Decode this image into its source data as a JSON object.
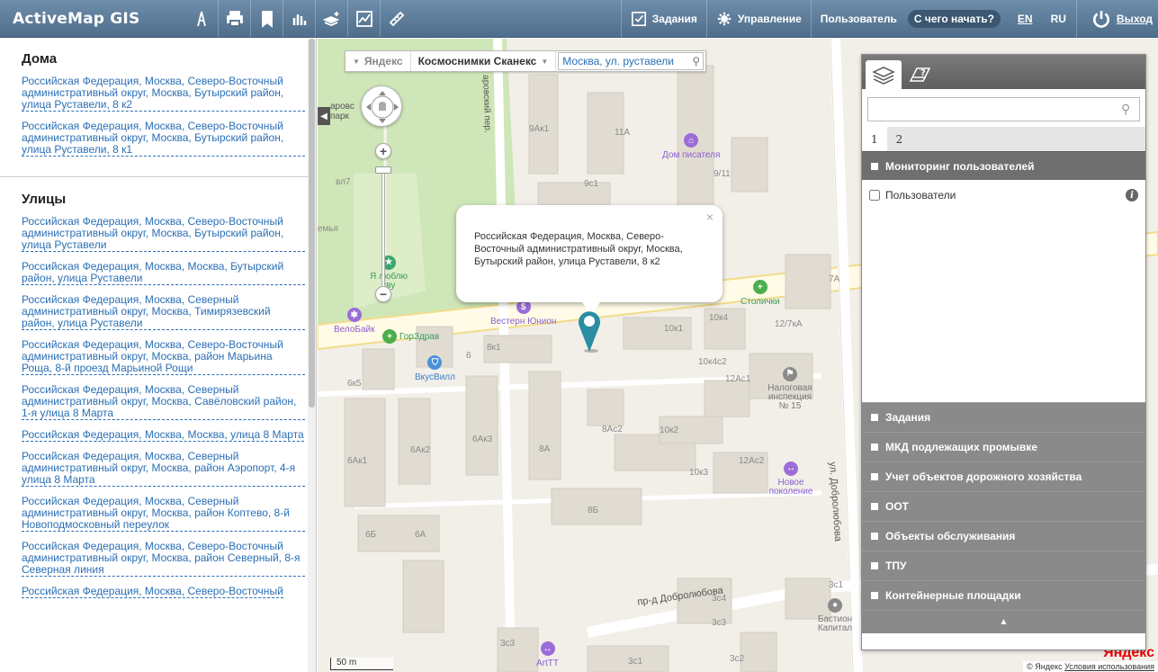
{
  "header": {
    "brand": "ActiveMap GIS",
    "tasks_label": "Задания",
    "manage_label": "Управление",
    "user_label": "Пользователь",
    "start_label": "С чего начать?",
    "lang_en": "EN",
    "lang_ru": "RU",
    "exit_label": "Выход",
    "tool_icons": [
      "compass-icon",
      "print-icon",
      "bookmark-icon",
      "bar-chart-icon",
      "layers-add-icon",
      "line-chart-icon",
      "ruler-icon"
    ]
  },
  "left_panel": {
    "houses_title": "Дома",
    "houses": [
      "Российская Федерация, Москва, Северо-Восточный административный округ, Москва, Бутырский район, улица Руставели, 8 к2",
      "Российская Федерация, Москва, Северо-Восточный административный округ, Москва, Бутырский район, улица Руставели, 8 к1"
    ],
    "streets_title": "Улицы",
    "streets": [
      "Российская Федерация, Москва, Северо-Восточный административный округ, Москва, Бутырский район, улица Руставели",
      "Российская Федерация, Москва, Москва, Бутырский район, улица Руставели",
      "Российская Федерация, Москва, Северный административный округ, Москва, Тимирязевский район, улица Руставели",
      "Российская Федерация, Москва, Северо-Восточный административный округ, Москва, район Марьина Роща, 8-й проезд Марьиной Рощи",
      "Российская Федерация, Москва, Северный административный округ, Москва, Савёловский район, 1-я улица 8 Марта",
      "Российская Федерация, Москва, Москва, улица 8 Марта",
      "Российская Федерация, Москва, Северный административный округ, Москва, район Аэропорт, 4-я улица 8 Марта",
      "Российская Федерация, Москва, Северный административный округ, Москва, район Коптево, 8-й Новоподмосковный переулок",
      "Российская Федерация, Москва, Северо-Восточный административный округ, Москва, район Северный, 8-я Северная линия",
      "Российская Федерация, Москва, Северо-Восточный"
    ]
  },
  "map": {
    "provider": "Яндекс",
    "layer": "Космоснимки Сканекс",
    "search_value": "Москва, ул. руставели",
    "popup_text": "Российская Федерация, Москва, Северо-Восточный административный округ, Москва, Бутырский район, улица Руставели, 8 к2",
    "popup_close": "×",
    "scale": "50 m",
    "copyright_prefix": "© Яндекс",
    "copyright_link": "Условия использования",
    "logo_text": "Яндекс",
    "labels": {
      "park": "аровс парк",
      "street_top": "аровский пер.",
      "b_9ak1": "9Ак1",
      "b_11a": "11А",
      "b_9c1": "9с1",
      "b_9_11": "9/11",
      "b_8a7": "вл7",
      "b_zemlya": "емья",
      "b_7a": "7А",
      "b_10k1": "10к1",
      "b_10k4": "10к4",
      "b_12_7ka": "12/7кА",
      "b_8k1": "8к1",
      "b_6": "6",
      "b_10k4c2": "10к4с2",
      "b_12ac1": "12Ас1",
      "b_6k5": "6к5",
      "b_8ac2": "8Ас2",
      "b_10k2": "10к2",
      "b_6ak3": "6Ак3",
      "b_6ak2": "6Ак2",
      "b_8a": "8А",
      "b_6ak1": "6Ак1",
      "b_12ac2": "12Ас2",
      "b_10k3": "10к3",
      "b_8b": "8Б",
      "b_6b": "6Б",
      "b_6a": "6А",
      "b_3c1": "3с1",
      "b_3c4": "3с4",
      "b_3c3a": "3с3",
      "b_3c3": "3с3",
      "b_3c2": "3с2",
      "b_3c1b": "3с1",
      "street_dob": "пр-д Добролюбова",
      "street_dob2": "ул. Добролюбова"
    },
    "pois": {
      "dom": "Дом писателя",
      "love": "Я люблю кву",
      "western": "Вестерн Юнион",
      "stolichki": "Столички",
      "velobike": "ВелоБайк",
      "gorzdrav": "ГорЗдрав",
      "vkusvill": "ВкусВилл",
      "nalog": "Налоговая инспекция № 15",
      "novoe": "Новое поколение",
      "bastion": "Бастион Капитал",
      "arttt": "ArtTT"
    }
  },
  "layers_panel": {
    "search_placeholder": "",
    "pages": [
      "1",
      "2"
    ],
    "open_section": "Мониторинг пользователей",
    "open_items": [
      {
        "label": "Пользователи",
        "checked": false
      }
    ],
    "sections": [
      "Задания",
      "МКД подлежащих промывке",
      "Учет объектов дорожного хозяйства",
      "ООТ",
      "Объекты обслуживания",
      "ТПУ",
      "Контейнерные площадки"
    ],
    "footer_icon": "▲"
  }
}
